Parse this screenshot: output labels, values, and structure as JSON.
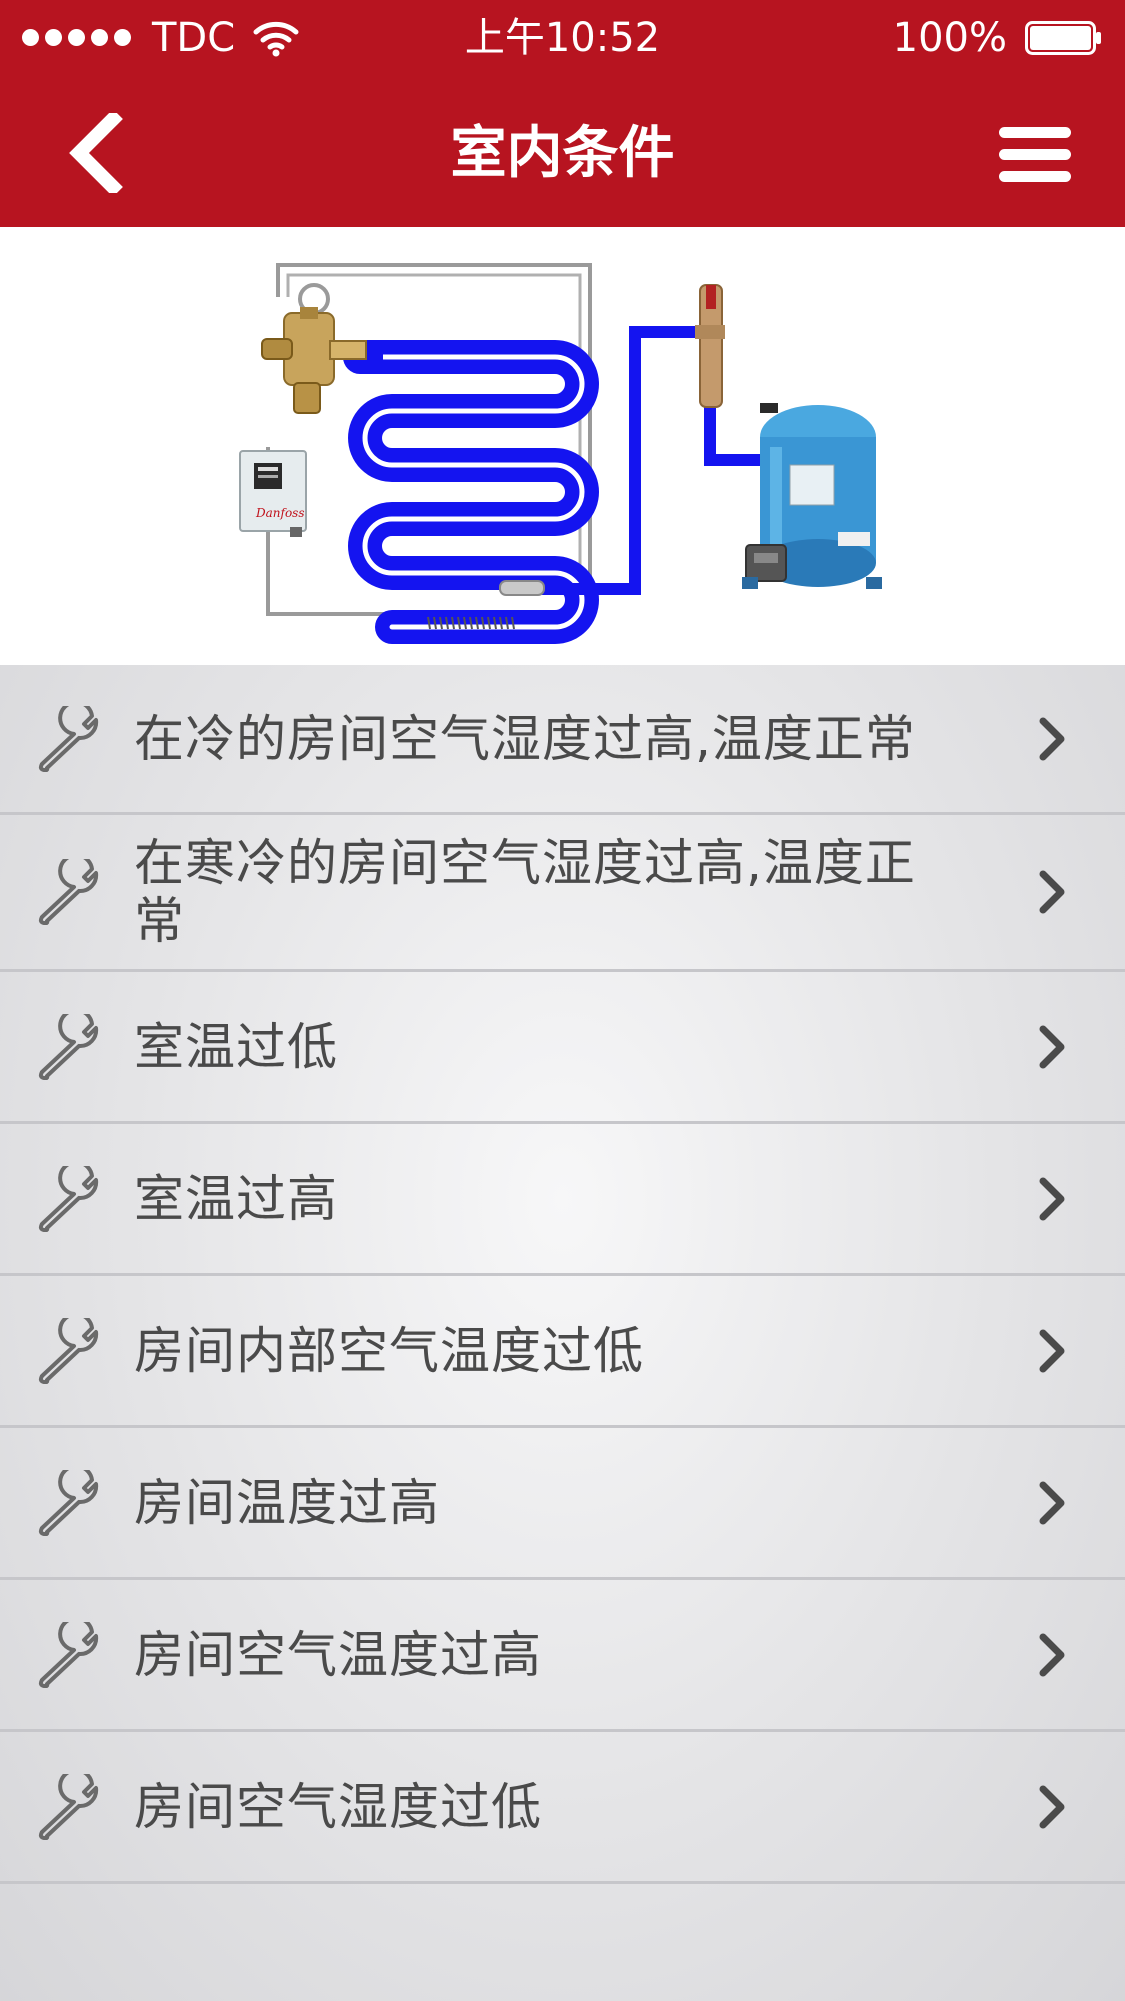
{
  "status_bar": {
    "carrier": "TDC",
    "time": "上午10:52",
    "battery": "100%",
    "signal_bars": 5
  },
  "nav": {
    "title": "室内条件",
    "back_icon": "chevron-left-icon",
    "menu_icon": "hamburger-menu-icon"
  },
  "diagram": {
    "image": "refrigeration-system-illustration"
  },
  "list": {
    "items": [
      {
        "label": "在冷的房间空气湿度过高,温度正常",
        "icon": "wrench-icon"
      },
      {
        "label": "在寒冷的房间空气湿度过高,温度正常",
        "icon": "wrench-icon"
      },
      {
        "label": "室温过低",
        "icon": "wrench-icon"
      },
      {
        "label": "室温过高",
        "icon": "wrench-icon"
      },
      {
        "label": "房间内部空气温度过低",
        "icon": "wrench-icon"
      },
      {
        "label": "房间温度过高",
        "icon": "wrench-icon"
      },
      {
        "label": "房间空气温度过高",
        "icon": "wrench-icon"
      },
      {
        "label": "房间空气湿度过低",
        "icon": "wrench-icon"
      }
    ]
  },
  "colors": {
    "header": "#b71420",
    "coil": "#1a1af0",
    "compressor": "#3a9ad8",
    "text": "#4a4a4a"
  }
}
